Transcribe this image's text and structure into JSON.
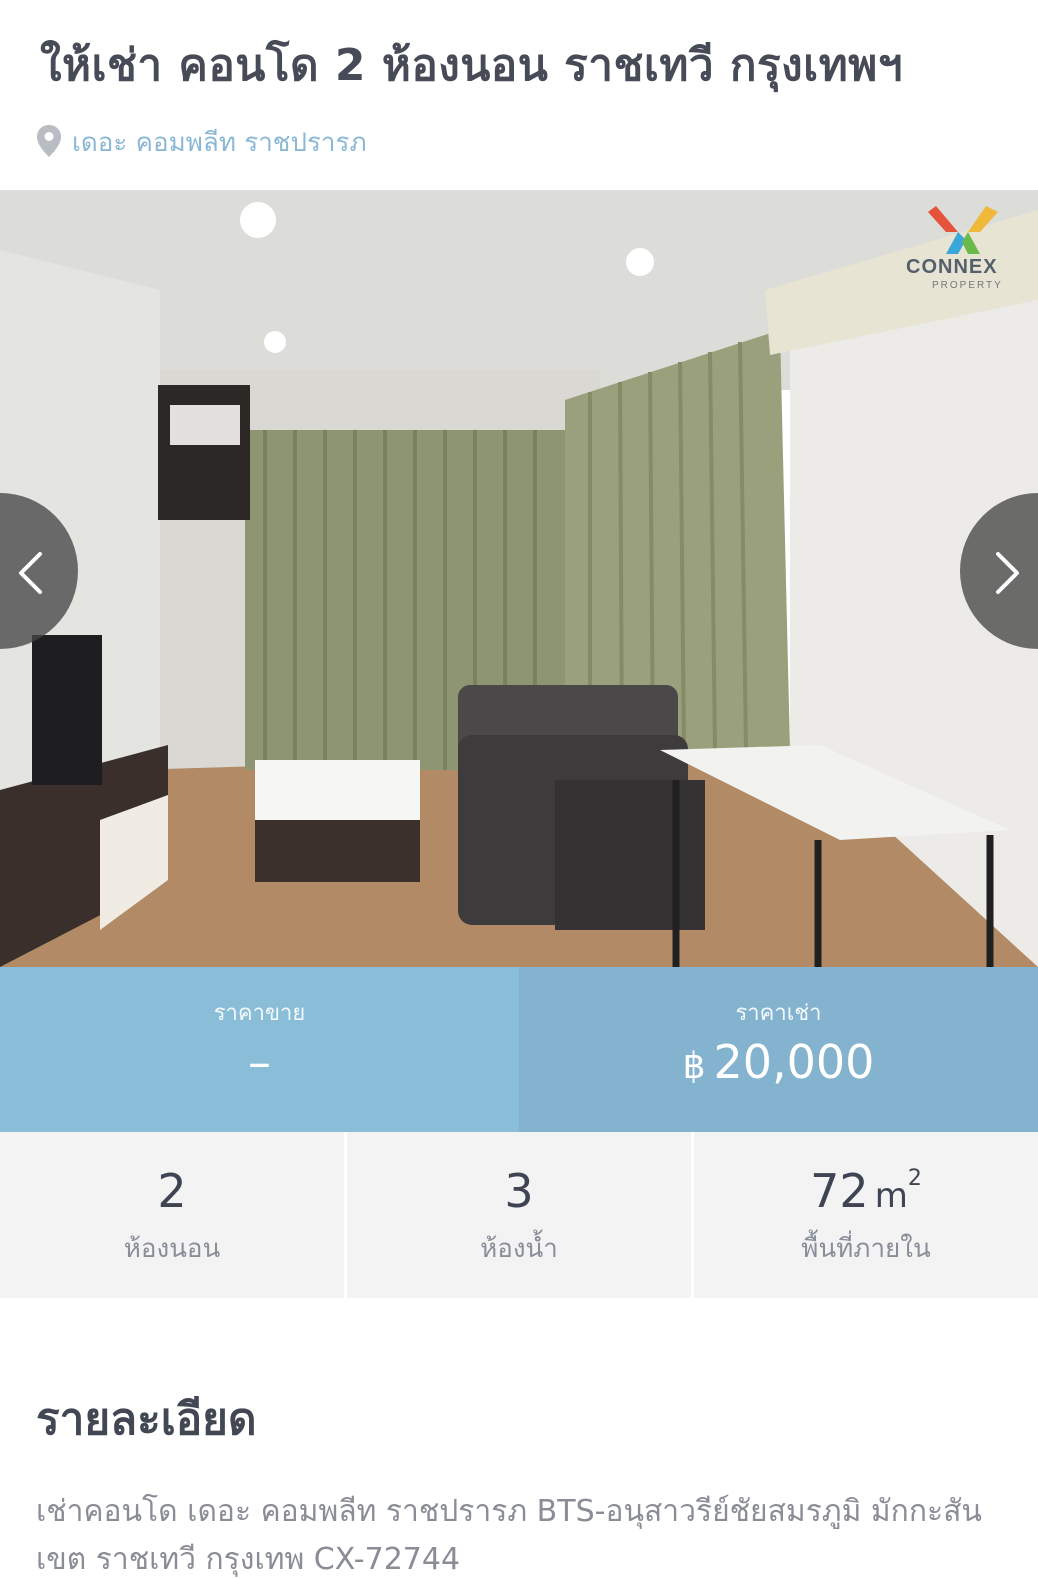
{
  "listing": {
    "title": "ให้เช่า คอนโด 2 ห้องนอน ราชเทวี กรุงเทพฯ",
    "location": "เดอะ คอมพลีท ราชปรารภ",
    "location_icon": "map-pin-icon"
  },
  "gallery": {
    "watermark_brand": "CONNEX",
    "watermark_sub": "PROPERTY",
    "prev_icon": "chevron-left-icon",
    "next_icon": "chevron-right-icon"
  },
  "price": {
    "sale_label": "ราคาขาย",
    "sale_value": "–",
    "rent_label": "ราคาเช่า",
    "currency_symbol": "฿",
    "rent_value": "20,000"
  },
  "stats": {
    "bedrooms_value": "2",
    "bedrooms_label": "ห้องนอน",
    "bathrooms_value": "3",
    "bathrooms_label": "ห้องน้ำ",
    "area_value": "72",
    "area_unit": "m",
    "area_unit_sup": "2",
    "area_label": "พื้นที่ภายใน"
  },
  "details": {
    "heading": "รายละเอียด",
    "description": "เช่าคอนโด เดอะ คอมพลีท ราชปรารภ BTS-อนุสาวรีย์ชัยสมรภูมิ มักกะสัน เขต ราชเทวี กรุงเทพ CX-72744"
  },
  "colors": {
    "accent_blue": "#89bdd8",
    "accent_blue_dark": "#83b3cf",
    "title_text": "#464b57",
    "location_text": "#8bb8d4",
    "stats_bg": "#f3f3f4"
  }
}
